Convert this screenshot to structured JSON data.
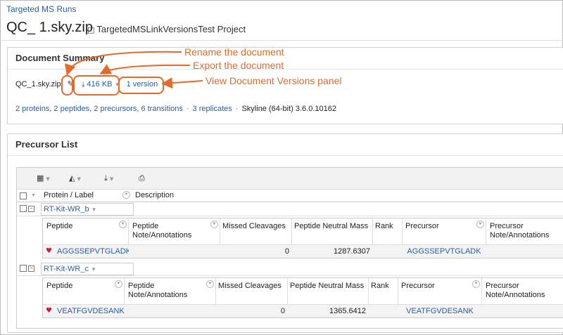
{
  "breadcrumb": "Targeted MS Runs",
  "title": "QC_ 1.sky.zip",
  "folder": "TargetedMSLinkVersionsTest Project",
  "summary": {
    "heading": "Document Summary",
    "doc_name": "QC_1.sky.zip",
    "size": "416 KB",
    "versions": "1 version",
    "stats": "2 proteins, 2 peptides, 2 precursors, 6 transitions",
    "replicates": "3 replicates",
    "software": "Skyline (64-bit) 3.6.0.10162"
  },
  "callouts": {
    "rename": "Rename the document",
    "export": "Export the document",
    "versions": "View Document Versions panel",
    "color": "#e46a2a"
  },
  "precursor_list": {
    "heading": "Precursor List",
    "columns": [
      "Protein / Label",
      "Description"
    ],
    "groups": [
      {
        "label": "RT-Kit-WR_b",
        "sub_headers": [
          "Peptide",
          "Peptide Note/Annotations",
          "Missed Cleavages",
          "Peptide Neutral Mass",
          "Rank",
          "Precursor",
          "Precursor Note/Annotations"
        ],
        "row": {
          "peptide": "AGGSSEPVTGLADK",
          "missed": "0",
          "mass": "1287.6307",
          "precursor": "AGGSSEPVTGLADK"
        }
      },
      {
        "label": "RT-Kit-WR_c",
        "sub_headers": [
          "Peptide",
          "Peptide Note/Annotations",
          "Missed Cleavages",
          "Peptide Neutral Mass",
          "Rank",
          "Precursor",
          "Precursor Note/Annotations"
        ],
        "row": {
          "peptide": "VEATFGVDESANK",
          "missed": "0",
          "mass": "1365.6412",
          "precursor": "VEATFGVDESANK"
        }
      }
    ]
  }
}
